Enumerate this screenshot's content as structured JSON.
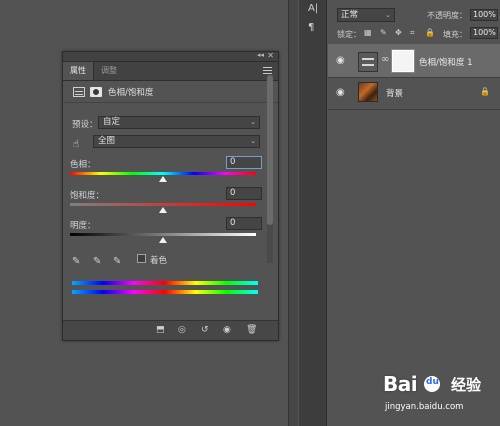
{
  "properties_panel": {
    "collapse_glyph": "◂◂",
    "close_glyph": "✕",
    "tabs": [
      {
        "label": "属性",
        "active": true
      },
      {
        "label": "调整",
        "active": false
      }
    ],
    "title": "色相/饱和度",
    "preset_label": "预设：",
    "preset_value": "自定",
    "range_value": "全图",
    "hue_label": "色相：",
    "hue_value": "0",
    "saturation_label": "饱和度：",
    "saturation_value": "0",
    "lightness_label": "明度：",
    "lightness_value": "0",
    "colorize_label": "着色",
    "colorize_checked": false,
    "slider_position_hue": 0.5,
    "slider_position_saturation": 0.5,
    "slider_position_lightness": 0.5
  },
  "layers_panel": {
    "toolstrip_glyphs": [
      "A|",
      "¶"
    ],
    "blend_mode": "正常",
    "opacity_label": "不透明度：",
    "opacity_value": "100%",
    "lock_label": "锁定：",
    "fill_label": "填充：",
    "fill_value": "100%",
    "layers": [
      {
        "name": "色相/饱和度 1",
        "selected": true,
        "type": "adjustment"
      },
      {
        "name": "背景",
        "selected": false,
        "type": "image"
      }
    ]
  },
  "watermark": {
    "brand": "Bai",
    "suffix": "经验",
    "url": "jingyan.baidu.com"
  },
  "colors": {
    "panel_bg": "#535353",
    "accent": "#7a9cc9"
  }
}
